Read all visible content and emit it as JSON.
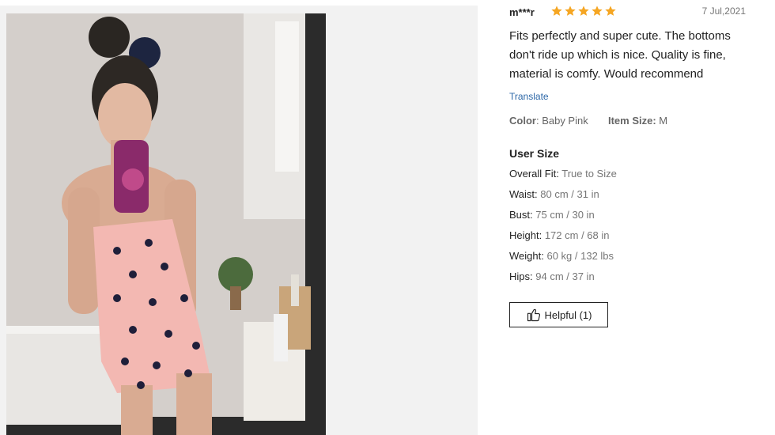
{
  "review": {
    "reviewer_name": "m***r",
    "rating": 5,
    "rating_max": 5,
    "star_color": "#f5a623",
    "date": "7 Jul,2021",
    "text": "Fits perfectly and super cute. The bottoms don't ride up which is nice. Quality is fine, material is comfy. Would recommend",
    "translate_label": "Translate",
    "color_label": "Color",
    "color_value": "Baby Pink",
    "item_size_label": "Item Size:",
    "item_size_value": "M"
  },
  "user_size": {
    "title": "User Size",
    "rows": [
      {
        "label": "Overall Fit:",
        "value": "True to Size"
      },
      {
        "label": "Waist:",
        "value": "80 cm / 31 in"
      },
      {
        "label": "Bust:",
        "value": "75 cm / 30 in"
      },
      {
        "label": "Height:",
        "value": "172 cm / 68 in"
      },
      {
        "label": "Weight:",
        "value": "60 kg / 132 lbs"
      },
      {
        "label": "Hips:",
        "value": "94 cm / 37 in"
      }
    ]
  },
  "helpful": {
    "label": "Helpful (1)",
    "icon": "thumbs-up-icon"
  },
  "photo": {
    "subject": "customer-review-photo"
  },
  "colors": {
    "link": "#2d68a8",
    "secondary_text": "#767676"
  }
}
